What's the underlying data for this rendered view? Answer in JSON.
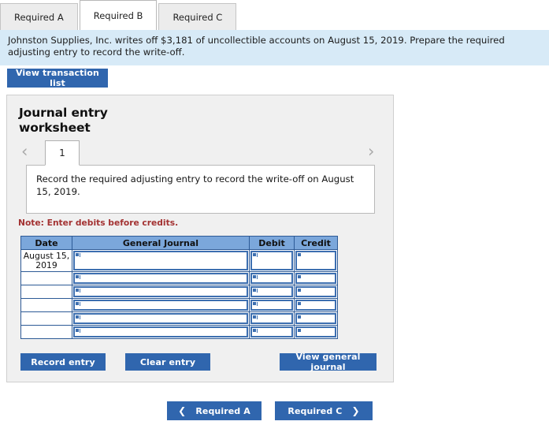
{
  "tabs": [
    {
      "label": "Required A",
      "active": false
    },
    {
      "label": "Required B",
      "active": true
    },
    {
      "label": "Required C",
      "active": false
    }
  ],
  "banner": {
    "text": "Johnston Supplies, Inc. writes off $3,181 of uncollectible accounts on August 15, 2019. Prepare the required adjusting entry to record the write-off."
  },
  "toolbar": {
    "view_transaction_list": "View transaction list"
  },
  "worksheet": {
    "title": "Journal entry worksheet",
    "prev_icon": "chevron-left-icon",
    "next_icon": "chevron-right-icon",
    "page_tab": "1",
    "instruction": "Record the required adjusting entry to record the write-off on August 15, 2019.",
    "note": "Note: Enter debits before credits.",
    "table": {
      "headers": [
        "Date",
        "General Journal",
        "Debit",
        "Credit"
      ],
      "rows": [
        {
          "date": "August 15, 2019",
          "general_journal": "",
          "debit": "",
          "credit": ""
        },
        {
          "date": "",
          "general_journal": "",
          "debit": "",
          "credit": ""
        },
        {
          "date": "",
          "general_journal": "",
          "debit": "",
          "credit": ""
        },
        {
          "date": "",
          "general_journal": "",
          "debit": "",
          "credit": ""
        },
        {
          "date": "",
          "general_journal": "",
          "debit": "",
          "credit": ""
        },
        {
          "date": "",
          "general_journal": "",
          "debit": "",
          "credit": ""
        }
      ]
    },
    "buttons": {
      "record_entry": "Record entry",
      "clear_entry": "Clear entry",
      "view_general_journal": "View general journal"
    }
  },
  "bottom_nav": {
    "prev_label": "Required A",
    "prev_icon": "chevron-left-icon",
    "next_label": "Required C",
    "next_icon": "chevron-right-icon"
  },
  "colors": {
    "accent_blue": "#3066ae",
    "banner_blue": "#d7eaf7",
    "table_header_blue": "#7ba7db",
    "table_border_blue": "#2d5a96",
    "note_red": "#a33232",
    "panel_gray": "#f0f0f0"
  }
}
